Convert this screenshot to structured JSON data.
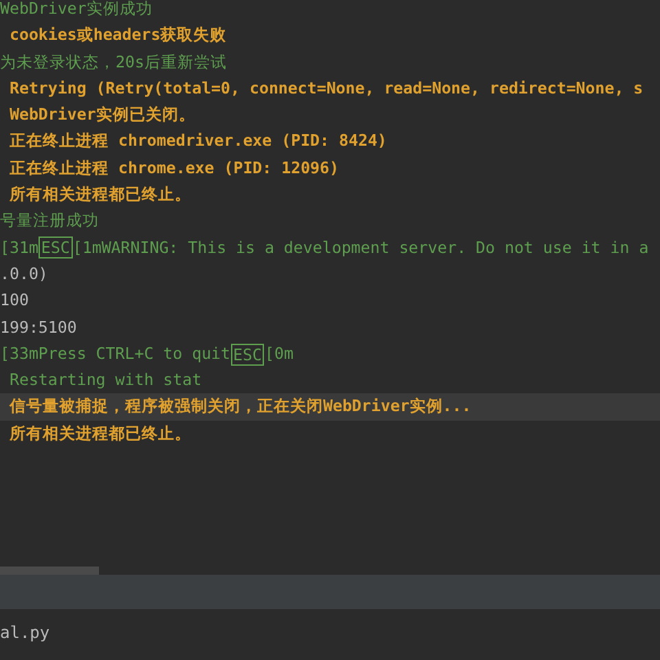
{
  "console": {
    "lines": [
      {
        "kind": "info",
        "highlighted": false,
        "parts": [
          {
            "kind": "plain",
            "text": "WebDriver实例成功"
          }
        ]
      },
      {
        "kind": "warning",
        "highlighted": false,
        "parts": [
          {
            "kind": "plain",
            "text": " cookies或headers获取失败"
          }
        ]
      },
      {
        "kind": "info",
        "highlighted": false,
        "parts": [
          {
            "kind": "plain",
            "text": "为未登录状态，20s后重新尝试"
          }
        ]
      },
      {
        "kind": "warning",
        "highlighted": false,
        "parts": [
          {
            "kind": "plain",
            "text": " Retrying (Retry(total=0, connect=None, read=None, redirect=None, s"
          }
        ]
      },
      {
        "kind": "warning",
        "highlighted": false,
        "parts": [
          {
            "kind": "plain",
            "text": " WebDriver实例已关闭。"
          }
        ]
      },
      {
        "kind": "warning",
        "highlighted": false,
        "parts": [
          {
            "kind": "plain",
            "text": " 正在终止进程 chromedriver.exe (PID: 8424)"
          }
        ]
      },
      {
        "kind": "warning",
        "highlighted": false,
        "parts": [
          {
            "kind": "plain",
            "text": " 正在终止进程 chrome.exe (PID: 12096)"
          }
        ]
      },
      {
        "kind": "warning",
        "highlighted": false,
        "parts": [
          {
            "kind": "plain",
            "text": " 所有相关进程都已终止。"
          }
        ]
      },
      {
        "kind": "info",
        "highlighted": false,
        "parts": [
          {
            "kind": "plain",
            "text": "号量注册成功"
          }
        ]
      },
      {
        "kind": "info",
        "highlighted": false,
        "parts": [
          {
            "kind": "plain",
            "text": "[31m"
          },
          {
            "kind": "escape",
            "text": "ESC"
          },
          {
            "kind": "plain",
            "text": "[1mWARNING: This is a development server. Do not use it in a"
          }
        ]
      },
      {
        "kind": "output",
        "highlighted": false,
        "parts": [
          {
            "kind": "plain",
            "text": ".0.0)"
          }
        ]
      },
      {
        "kind": "output",
        "highlighted": false,
        "parts": [
          {
            "kind": "plain",
            "text": "100"
          }
        ]
      },
      {
        "kind": "output",
        "highlighted": false,
        "parts": [
          {
            "kind": "plain",
            "text": "199:5100"
          }
        ]
      },
      {
        "kind": "info",
        "highlighted": false,
        "parts": [
          {
            "kind": "plain",
            "text": "[33mPress CTRL+C to quit"
          },
          {
            "kind": "escape",
            "text": "ESC"
          },
          {
            "kind": "plain",
            "text": "[0m"
          }
        ]
      },
      {
        "kind": "info",
        "highlighted": false,
        "parts": [
          {
            "kind": "plain",
            "text": " Restarting with stat"
          }
        ]
      },
      {
        "kind": "warning",
        "highlighted": true,
        "parts": [
          {
            "kind": "plain",
            "text": " 信号量被捕捉，程序被强制关闭，正在关闭WebDriver实例..."
          }
        ]
      },
      {
        "kind": "warning",
        "highlighted": false,
        "parts": [
          {
            "kind": "plain",
            "text": " 所有相关进程都已终止。"
          }
        ]
      }
    ]
  },
  "status": {
    "file_label": "al.py"
  }
}
